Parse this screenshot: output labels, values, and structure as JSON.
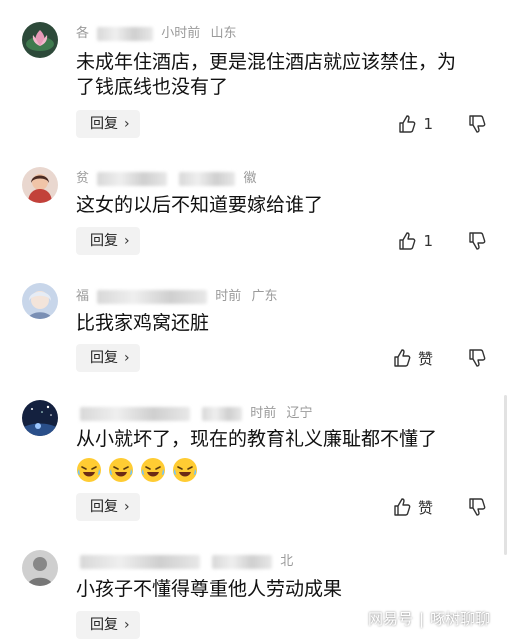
{
  "colors": {
    "reply_bg": "#f2f2f2",
    "meta": "#9a9a9a",
    "text": "#111111"
  },
  "comments": [
    {
      "avatar": "lotus-avatar",
      "meta_prefix": "各",
      "meta_time": "小时前",
      "meta_location": "山东",
      "text": "未成年住酒店，更是混住酒店就应该禁住，为了钱底线也没有了",
      "reply": "回复",
      "likes": "1"
    },
    {
      "avatar": "woman-avatar",
      "meta_prefix": "贫",
      "meta_time": "",
      "meta_location": "徽",
      "text": "这女的以后不知道要嫁给谁了",
      "reply": "回复",
      "likes": "1"
    },
    {
      "avatar": "character-avatar",
      "meta_prefix": "福",
      "meta_time": "时前",
      "meta_location": "广东",
      "text": "比我家鸡窝还脏",
      "reply": "回复",
      "likes": "赞"
    },
    {
      "avatar": "night-avatar",
      "meta_prefix": "",
      "meta_time": "时前",
      "meta_location": "辽宁",
      "text": "从小就坏了，现在的教育礼义廉耻都不懂了",
      "emoji": "laughing-crying-emoji",
      "reply": "回复",
      "likes": "赞"
    },
    {
      "avatar": "gray-avatar",
      "meta_prefix": "",
      "meta_time": "",
      "meta_location": "北",
      "text": "小孩子不懂得尊重他人劳动成果",
      "reply": "回复",
      "likes": ""
    }
  ],
  "watermark": {
    "source": "网易号",
    "author": "啄树聊聊"
  }
}
